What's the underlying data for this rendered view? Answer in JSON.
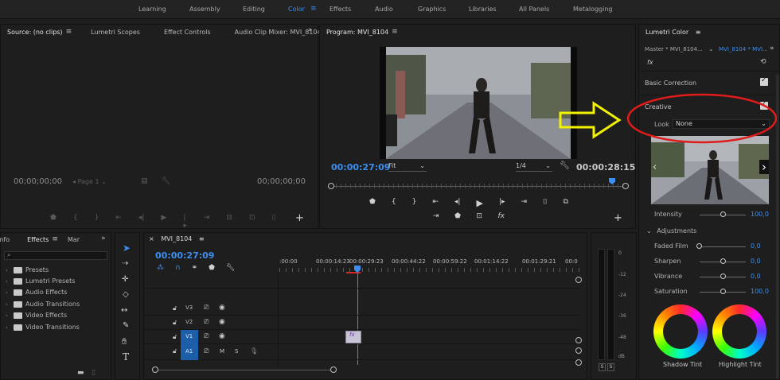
{
  "workspaces": {
    "items": [
      "Learning",
      "Assembly",
      "Editing",
      "Color",
      "Effects",
      "Audio",
      "Graphics",
      "Libraries",
      "All Panels",
      "Metalogging"
    ],
    "active": "Color"
  },
  "source_panel": {
    "tabs": [
      "Source: (no clips)",
      "Lumetri Scopes",
      "Effect Controls",
      "Audio Clip Mixer: MVI_8104"
    ],
    "timecode_left": "00;00;00;00",
    "timecode_right": "00;00;00;00",
    "page": "Page 1"
  },
  "program_panel": {
    "title": "Program: MVI_8104",
    "timecode_current": "00:00:27:09",
    "timecode_duration": "00:00:28:15",
    "fit": "Fit",
    "resolution": "1/4"
  },
  "lumetri": {
    "title": "Lumetri Color",
    "master": "Master * MVI_8104...",
    "clip": "MVI_8104 * MVI...",
    "fx": "fx",
    "basic_correction": "Basic Correction",
    "creative": "Creative",
    "look_label": "Look",
    "look_value": "None",
    "intensity_label": "Intensity",
    "intensity_value": "100,0",
    "adjustments_label": "Adjustments",
    "faded_film_label": "Faded Film",
    "faded_film_value": "0,0",
    "sharpen_label": "Sharpen",
    "sharpen_value": "0,0",
    "vibrance_label": "Vibrance",
    "vibrance_value": "0,0",
    "saturation_label": "Saturation",
    "saturation_value": "100,0",
    "shadow_tint": "Shadow Tint",
    "highlight_tint": "Highlight Tint"
  },
  "effects_panel": {
    "tabs": [
      "Info",
      "Effects",
      "Mar"
    ],
    "items": [
      "Presets",
      "Lumetri Presets",
      "Audio Effects",
      "Audio Transitions",
      "Video Effects",
      "Video Transitions"
    ]
  },
  "timeline": {
    "title": "MVI_8104",
    "timecode": "00:00:27:09",
    "ruler": [
      ":00:00",
      "00:00:14:23",
      "00:00:29:23",
      "00:00:44:22",
      "00:00:59:22",
      "00:01:14:22",
      "00:01:29:21",
      "00:0"
    ],
    "tracks": [
      {
        "name": "V3",
        "type": "video"
      },
      {
        "name": "V2",
        "type": "video"
      },
      {
        "name": "V1",
        "type": "video"
      },
      {
        "name": "A1",
        "type": "audio"
      }
    ],
    "mute": "M",
    "solo": "S",
    "clip_label": "fx"
  },
  "meters": {
    "scale": [
      "0",
      "-12",
      "-24",
      "-36",
      "-48",
      "dB"
    ],
    "solo_left": "S",
    "solo_right": "S"
  },
  "colors": {
    "accent": "#3d8ef0",
    "annotation_red": "#e01b1b",
    "annotation_yellow": "#f2f200"
  }
}
